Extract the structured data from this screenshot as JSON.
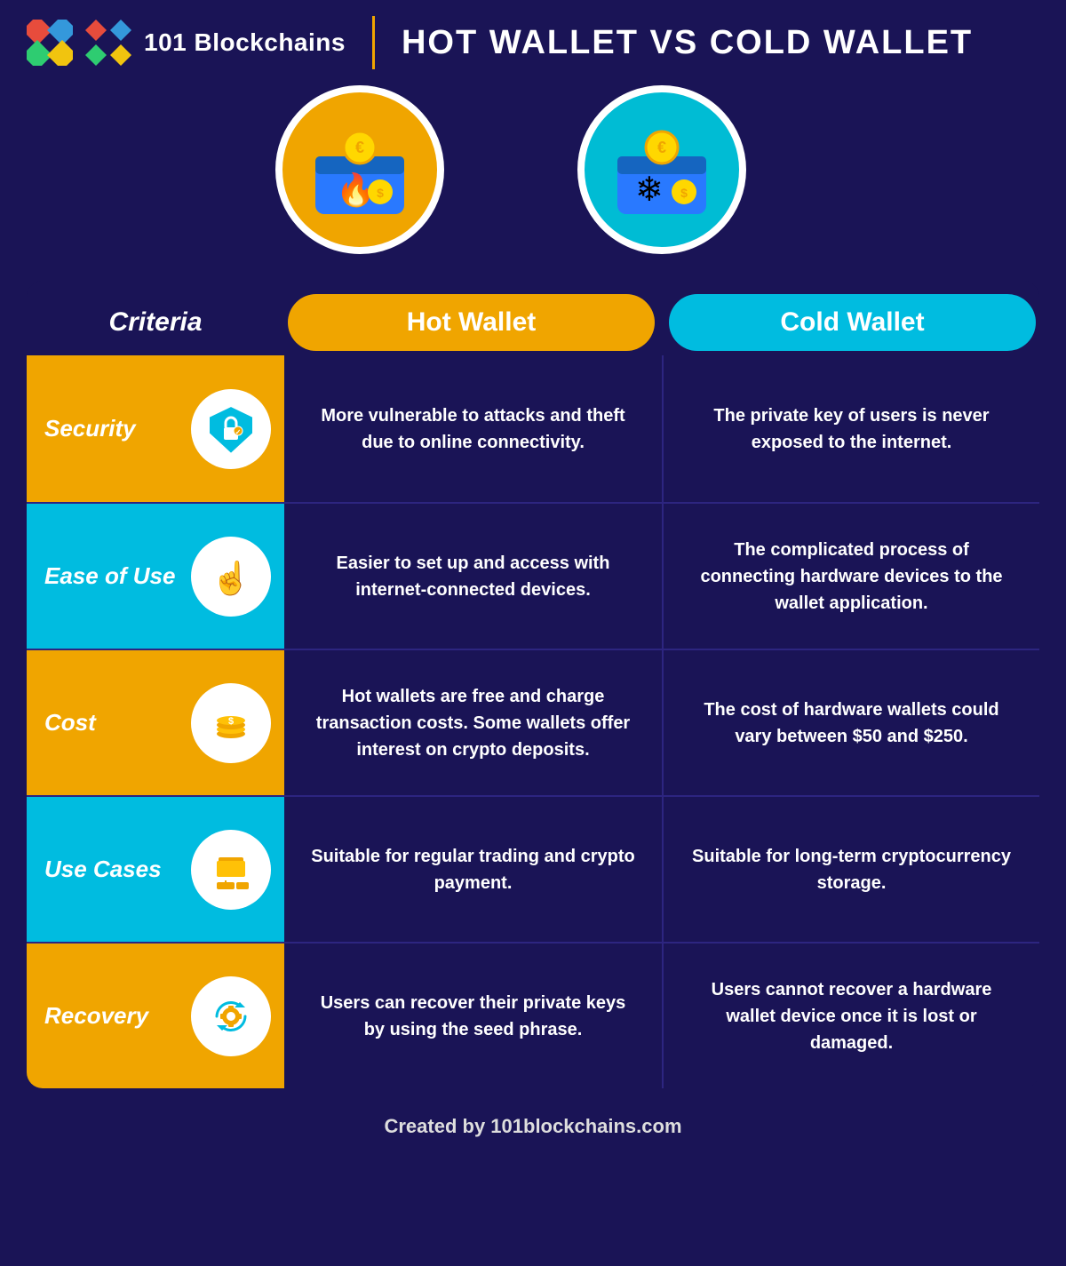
{
  "header": {
    "logo_text": "101 Blockchains",
    "title": "HOT WALLET VS COLD WALLET"
  },
  "column_headers": {
    "criteria": "Criteria",
    "hot_wallet": "Hot Wallet",
    "cold_wallet": "Cold Wallet"
  },
  "rows": [
    {
      "id": "security",
      "label": "Security",
      "icon_emoji": "🛡",
      "color": "orange",
      "hot_text": "More vulnerable to attacks and theft due to online connectivity.",
      "cold_text": "The private key of users is never exposed to the internet."
    },
    {
      "id": "ease-of-use",
      "label": "Ease of Use",
      "icon_emoji": "👆",
      "color": "blue",
      "hot_text": "Easier to set up and access with internet-connected devices.",
      "cold_text": "The complicated process of connecting hardware devices to the wallet application."
    },
    {
      "id": "cost",
      "label": "Cost",
      "icon_emoji": "💰",
      "color": "orange",
      "hot_text": "Hot wallets are free and charge transaction costs. Some wallets offer interest on crypto deposits.",
      "cold_text": "The cost of hardware wallets could vary between $50 and $250."
    },
    {
      "id": "use-cases",
      "label": "Use Cases",
      "icon_emoji": "📁",
      "color": "blue",
      "hot_text": "Suitable for regular trading and crypto payment.",
      "cold_text": "Suitable for long-term cryptocurrency storage."
    },
    {
      "id": "recovery",
      "label": "Recovery",
      "icon_emoji": "⚙",
      "color": "orange",
      "hot_text": "Users can recover their private keys by using the seed phrase.",
      "cold_text": "Users cannot recover a hardware wallet device once it is lost or damaged."
    }
  ],
  "footer": {
    "text": "Created by 101blockchains.com"
  },
  "hot_wallet_icon": "🔥",
  "cold_wallet_icon": "❄"
}
